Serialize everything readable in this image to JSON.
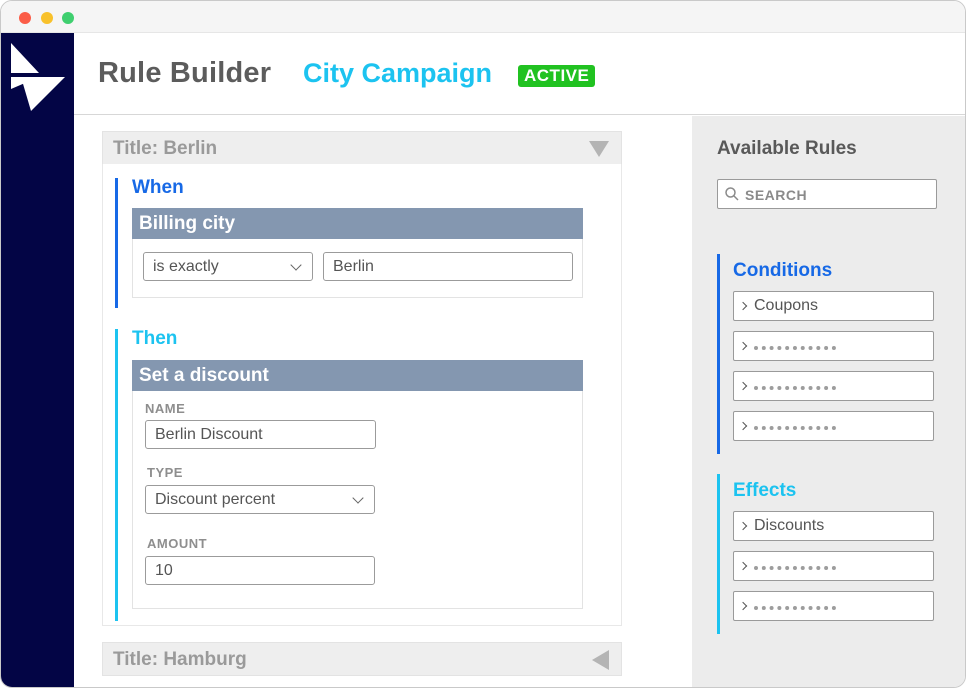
{
  "header": {
    "app_title": "Rule Builder",
    "campaign_name": "City Campaign",
    "status_badge": "ACTIVE"
  },
  "rules": [
    {
      "title": "Title: Berlin",
      "expanded": true,
      "when": {
        "label": "When",
        "condition": {
          "name": "Billing city",
          "operator": "is exactly",
          "value": "Berlin"
        }
      },
      "then": {
        "label": "Then",
        "effect": {
          "name": "Set a discount",
          "name_label": "NAME",
          "name_value": "Berlin Discount",
          "type_label": "TYPE",
          "type_value": "Discount percent",
          "amount_label": "AMOUNT",
          "amount_value": "10"
        }
      }
    },
    {
      "title": "Title: Hamburg",
      "expanded": false
    }
  ],
  "sidebar": {
    "title": "Available Rules",
    "search_placeholder": "SEARCH",
    "conditions": {
      "label": "Conditions",
      "items": [
        "Coupons",
        "",
        "",
        ""
      ]
    },
    "effects": {
      "label": "Effects",
      "items": [
        "Discounts",
        "",
        ""
      ]
    }
  },
  "colors": {
    "nav_background": "#030545",
    "accent_blue": "#1769e6",
    "accent_cyan": "#1cc3f0",
    "badge_green": "#21c221",
    "card_header": "#8497b0"
  },
  "icons": {
    "logo": "logo-icon",
    "search": "search-icon",
    "collapse": "triangle-down-icon",
    "expand": "triangle-left-icon",
    "dropdown": "chevron-down-icon",
    "list_item": "chevron-right-icon"
  }
}
